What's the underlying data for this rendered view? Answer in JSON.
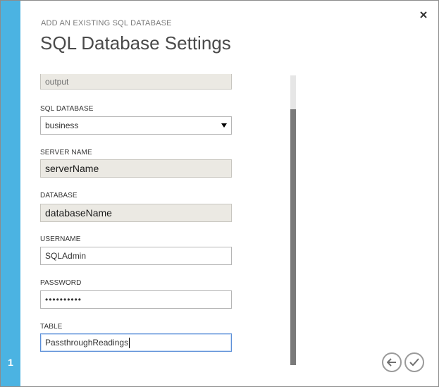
{
  "dialog": {
    "subtitle": "ADD AN EXISTING SQL DATABASE",
    "title": "SQL Database Settings",
    "step_number": "1"
  },
  "icons": {
    "close": "close-icon",
    "back": "back-arrow-icon",
    "finish": "checkmark-icon",
    "dropdown": "chevron-down-icon"
  },
  "form": {
    "output_alias": {
      "value": "output"
    },
    "sql_database": {
      "label": "SQL DATABASE",
      "value": "business"
    },
    "server_name": {
      "label": "SERVER NAME",
      "value": "serverName"
    },
    "database": {
      "label": "DATABASE",
      "value": "databaseName"
    },
    "username": {
      "label": "USERNAME",
      "value": "SQLAdmin"
    },
    "password": {
      "label": "PASSWORD",
      "value": "••••••••••"
    },
    "table": {
      "label": "TABLE",
      "value": "PassthroughReadings"
    }
  },
  "colors": {
    "accent_strip": "#4bb3e2",
    "readonly_bg": "#ebe9e3",
    "focus_border": "#5c8fd8"
  }
}
